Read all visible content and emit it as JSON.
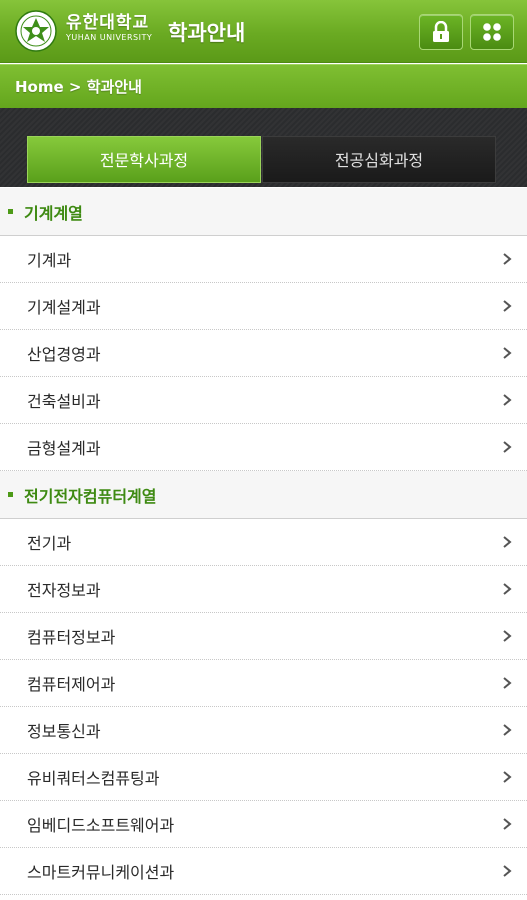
{
  "header": {
    "logo_kr": "유한대학교",
    "logo_en": "YUHAN UNIVERSITY",
    "title": "학과안내",
    "lock_icon": "lock-icon",
    "menu_icon": "grid-menu-icon"
  },
  "breadcrumb": {
    "home": "Home",
    "separator": " > ",
    "current": "학과안내"
  },
  "tabs": [
    {
      "label": "전문학사과정",
      "active": true
    },
    {
      "label": "전공심화과정",
      "active": false
    }
  ],
  "sections": [
    {
      "title": "기계계열",
      "items": [
        "기계과",
        "기계설계과",
        "산업경영과",
        "건축설비과",
        "금형설계과"
      ]
    },
    {
      "title": "전기전자컴퓨터계열",
      "items": [
        "전기과",
        "전자정보과",
        "컴퓨터정보과",
        "컴퓨터제어과",
        "정보통신과",
        "유비쿼터스컴퓨팅과",
        "임베디드소프트웨어과",
        "스마트커뮤니케이션과"
      ]
    }
  ],
  "colors": {
    "brand_green": "#6aaa22",
    "section_title": "#3e8a12",
    "tab_dark": "#2b2c2e"
  }
}
